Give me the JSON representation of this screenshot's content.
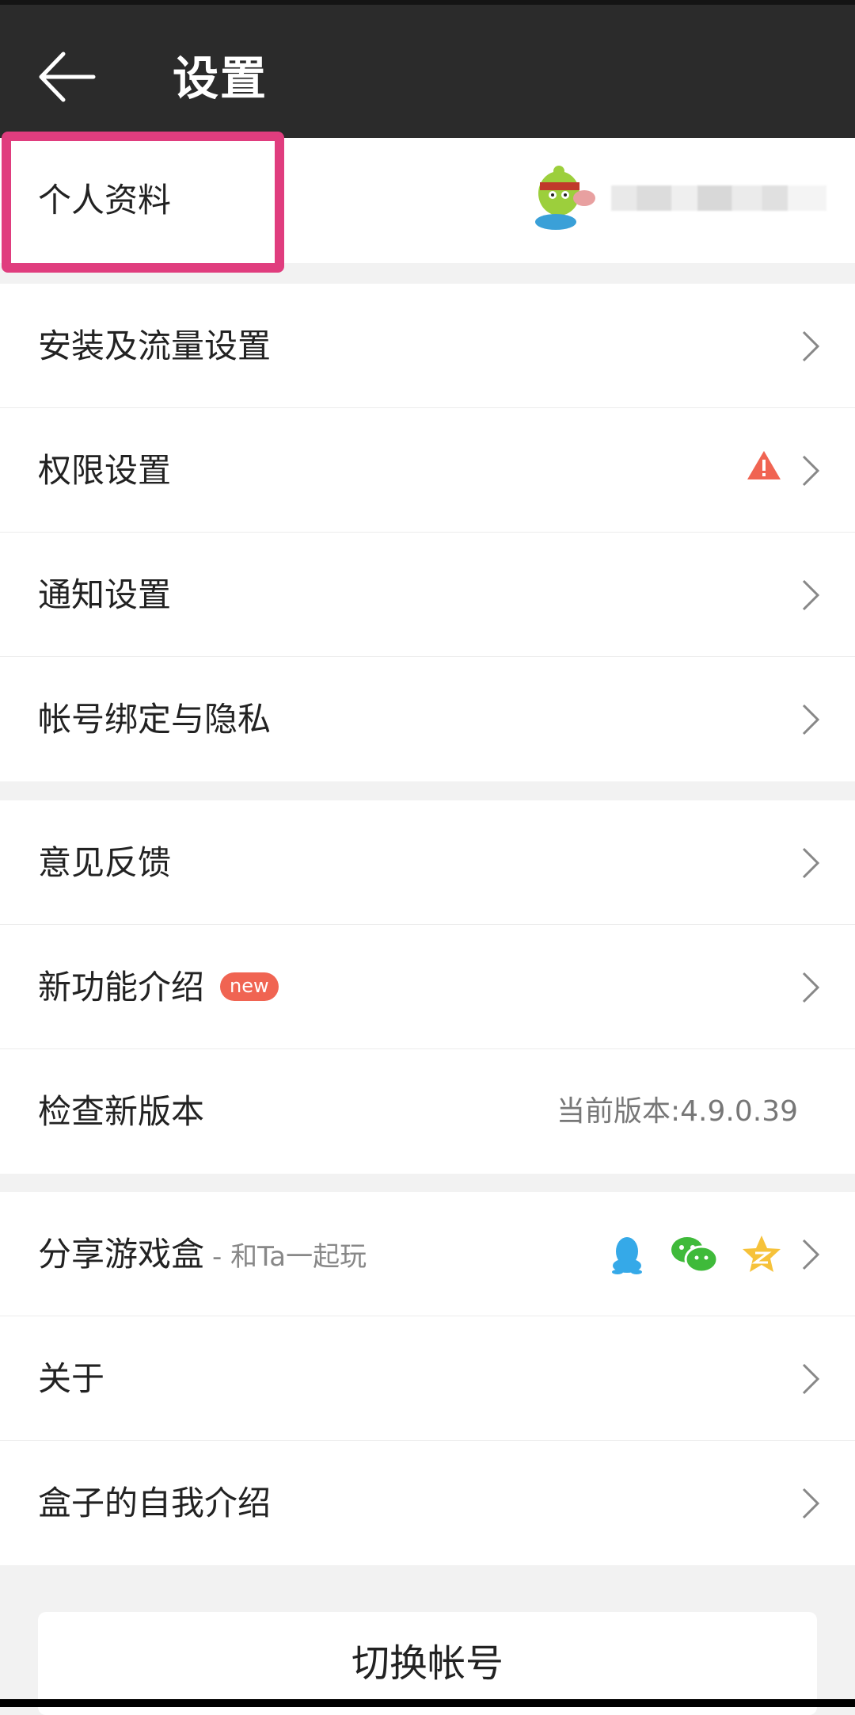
{
  "header": {
    "title": "设置"
  },
  "profile": {
    "label": "个人资料"
  },
  "group1": [
    {
      "label": "安装及流量设置"
    },
    {
      "label": "权限设置"
    },
    {
      "label": "通知设置"
    },
    {
      "label": "帐号绑定与隐私"
    }
  ],
  "group2": {
    "feedback": "意见反馈",
    "new_features": "新功能介绍",
    "new_badge": "new",
    "check_update": "检查新版本",
    "version": "当前版本:4.9.0.39"
  },
  "group3": {
    "share_label": "分享游戏盒",
    "share_sub": "- 和Ta一起玩",
    "share_icons": [
      "qq-icon",
      "wechat-icon",
      "qzone-icon"
    ],
    "about": "关于",
    "intro": "盒子的自我介绍"
  },
  "footer": {
    "switch_account": "切换帐号"
  },
  "colors": {
    "header_bg": "#2b2b2b",
    "highlight": "#e03d7e",
    "badge": "#f06452",
    "warning": "#f06452",
    "qq": "#35a9e8",
    "wechat": "#3fba3a",
    "qzone": "#f6c23a"
  }
}
